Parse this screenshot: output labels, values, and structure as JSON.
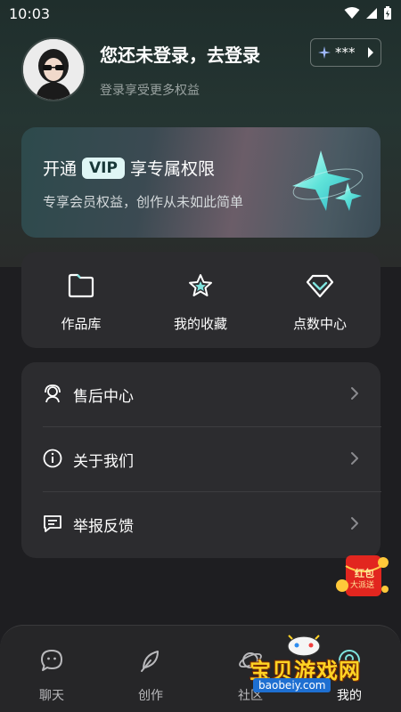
{
  "status_bar": {
    "time": "10:03"
  },
  "profile": {
    "login_title": "您还未登录，去登录",
    "login_subtitle": "登录享受更多权益",
    "points_value": "***"
  },
  "vip_banner": {
    "title_prefix": "开通",
    "badge": "VIP",
    "title_suffix": "享专属权限",
    "subtitle": "专享会员权益，创作从未如此简单"
  },
  "quick_actions": [
    {
      "label": "作品库",
      "icon": "folder-icon"
    },
    {
      "label": "我的收藏",
      "icon": "star-icon"
    },
    {
      "label": "点数中心",
      "icon": "diamond-icon"
    }
  ],
  "menu": [
    {
      "label": "售后中心",
      "icon": "customer-service-icon"
    },
    {
      "label": "关于我们",
      "icon": "info-icon"
    },
    {
      "label": "举报反馈",
      "icon": "feedback-icon"
    }
  ],
  "red_envelope": {
    "line1": "红包",
    "line2": "大派送"
  },
  "bottom_nav": [
    {
      "label": "聊天",
      "icon": "chat-icon"
    },
    {
      "label": "创作",
      "icon": "feather-icon"
    },
    {
      "label": "社区",
      "icon": "planet-icon"
    },
    {
      "label": "我的",
      "icon": "profile-icon"
    }
  ],
  "watermark": {
    "title": "宝贝游戏网",
    "url": "baobeiy.com"
  },
  "colors": {
    "accent": "#7fe3de",
    "card_bg": "#2c2c2f",
    "page_bg": "#1e1e21",
    "watermark_yellow": "#ffd324"
  }
}
